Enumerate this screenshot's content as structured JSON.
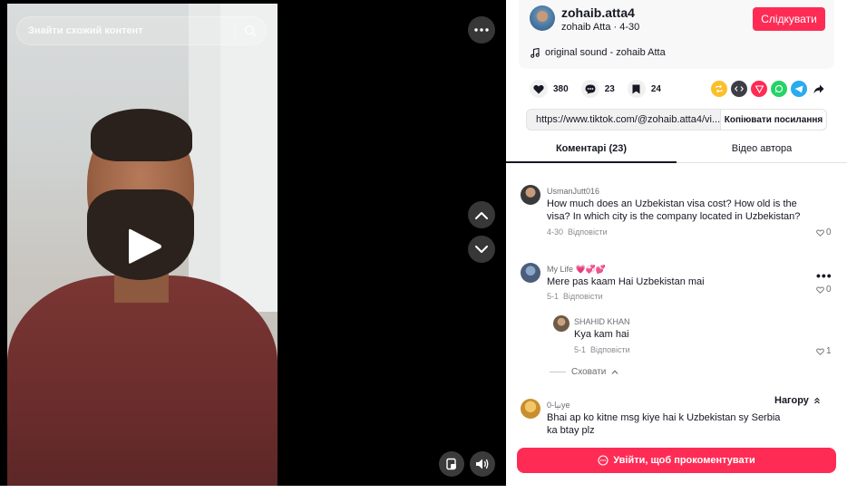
{
  "search": {
    "placeholder": "Знайти схожий контент"
  },
  "author": {
    "handle": "zohaib.atta4",
    "meta": "zohaib Atta · 4-30",
    "follow_label": "Слідкувати",
    "music": "original sound - zohaib Atta"
  },
  "stats": {
    "likes": "380",
    "comments": "23",
    "saves": "24"
  },
  "share_icons": [
    "repost-icon",
    "embed-icon",
    "send-icon",
    "whatsapp-icon",
    "telegram-icon",
    "share-arrow-icon"
  ],
  "colors": {
    "accent": "#fe2c55",
    "text": "#161823",
    "muted": "#8a8b91"
  },
  "link": {
    "url": "https://www.tiktok.com/@zohaib.atta4/vi...",
    "copy_label": "Копіювати посилання"
  },
  "tabs": [
    {
      "label": "Коментарі (23)"
    },
    {
      "label": "Відео автора"
    }
  ],
  "comments": [
    {
      "user": "UsmanJutt016",
      "text": "How much does an Uzbekistan visa cost? How old is the visa? In which city is the company located in Uzbekistan?",
      "date": "4-30",
      "reply": "Відповісти",
      "likes": "0"
    },
    {
      "user": "My Life 💗💞💕",
      "text": "Mere pas kaam Hai Uzbekistan mai",
      "date": "5-1",
      "reply": "Відповісти",
      "likes": "0",
      "replies": [
        {
          "user": "SHAHID KHAN",
          "text": "Kya kam hai",
          "date": "5-1",
          "reply": "Відповісти",
          "likes": "1"
        }
      ],
      "collapse_label": "Сховати"
    },
    {
      "user": "0-نیاye",
      "text": "Bhai ap ko kitne msg kiye hai k Uzbekistan sy Serbia ka btay plz"
    }
  ],
  "top_button": "Нагору",
  "login_label": "Увійти, щоб прокоментувати"
}
